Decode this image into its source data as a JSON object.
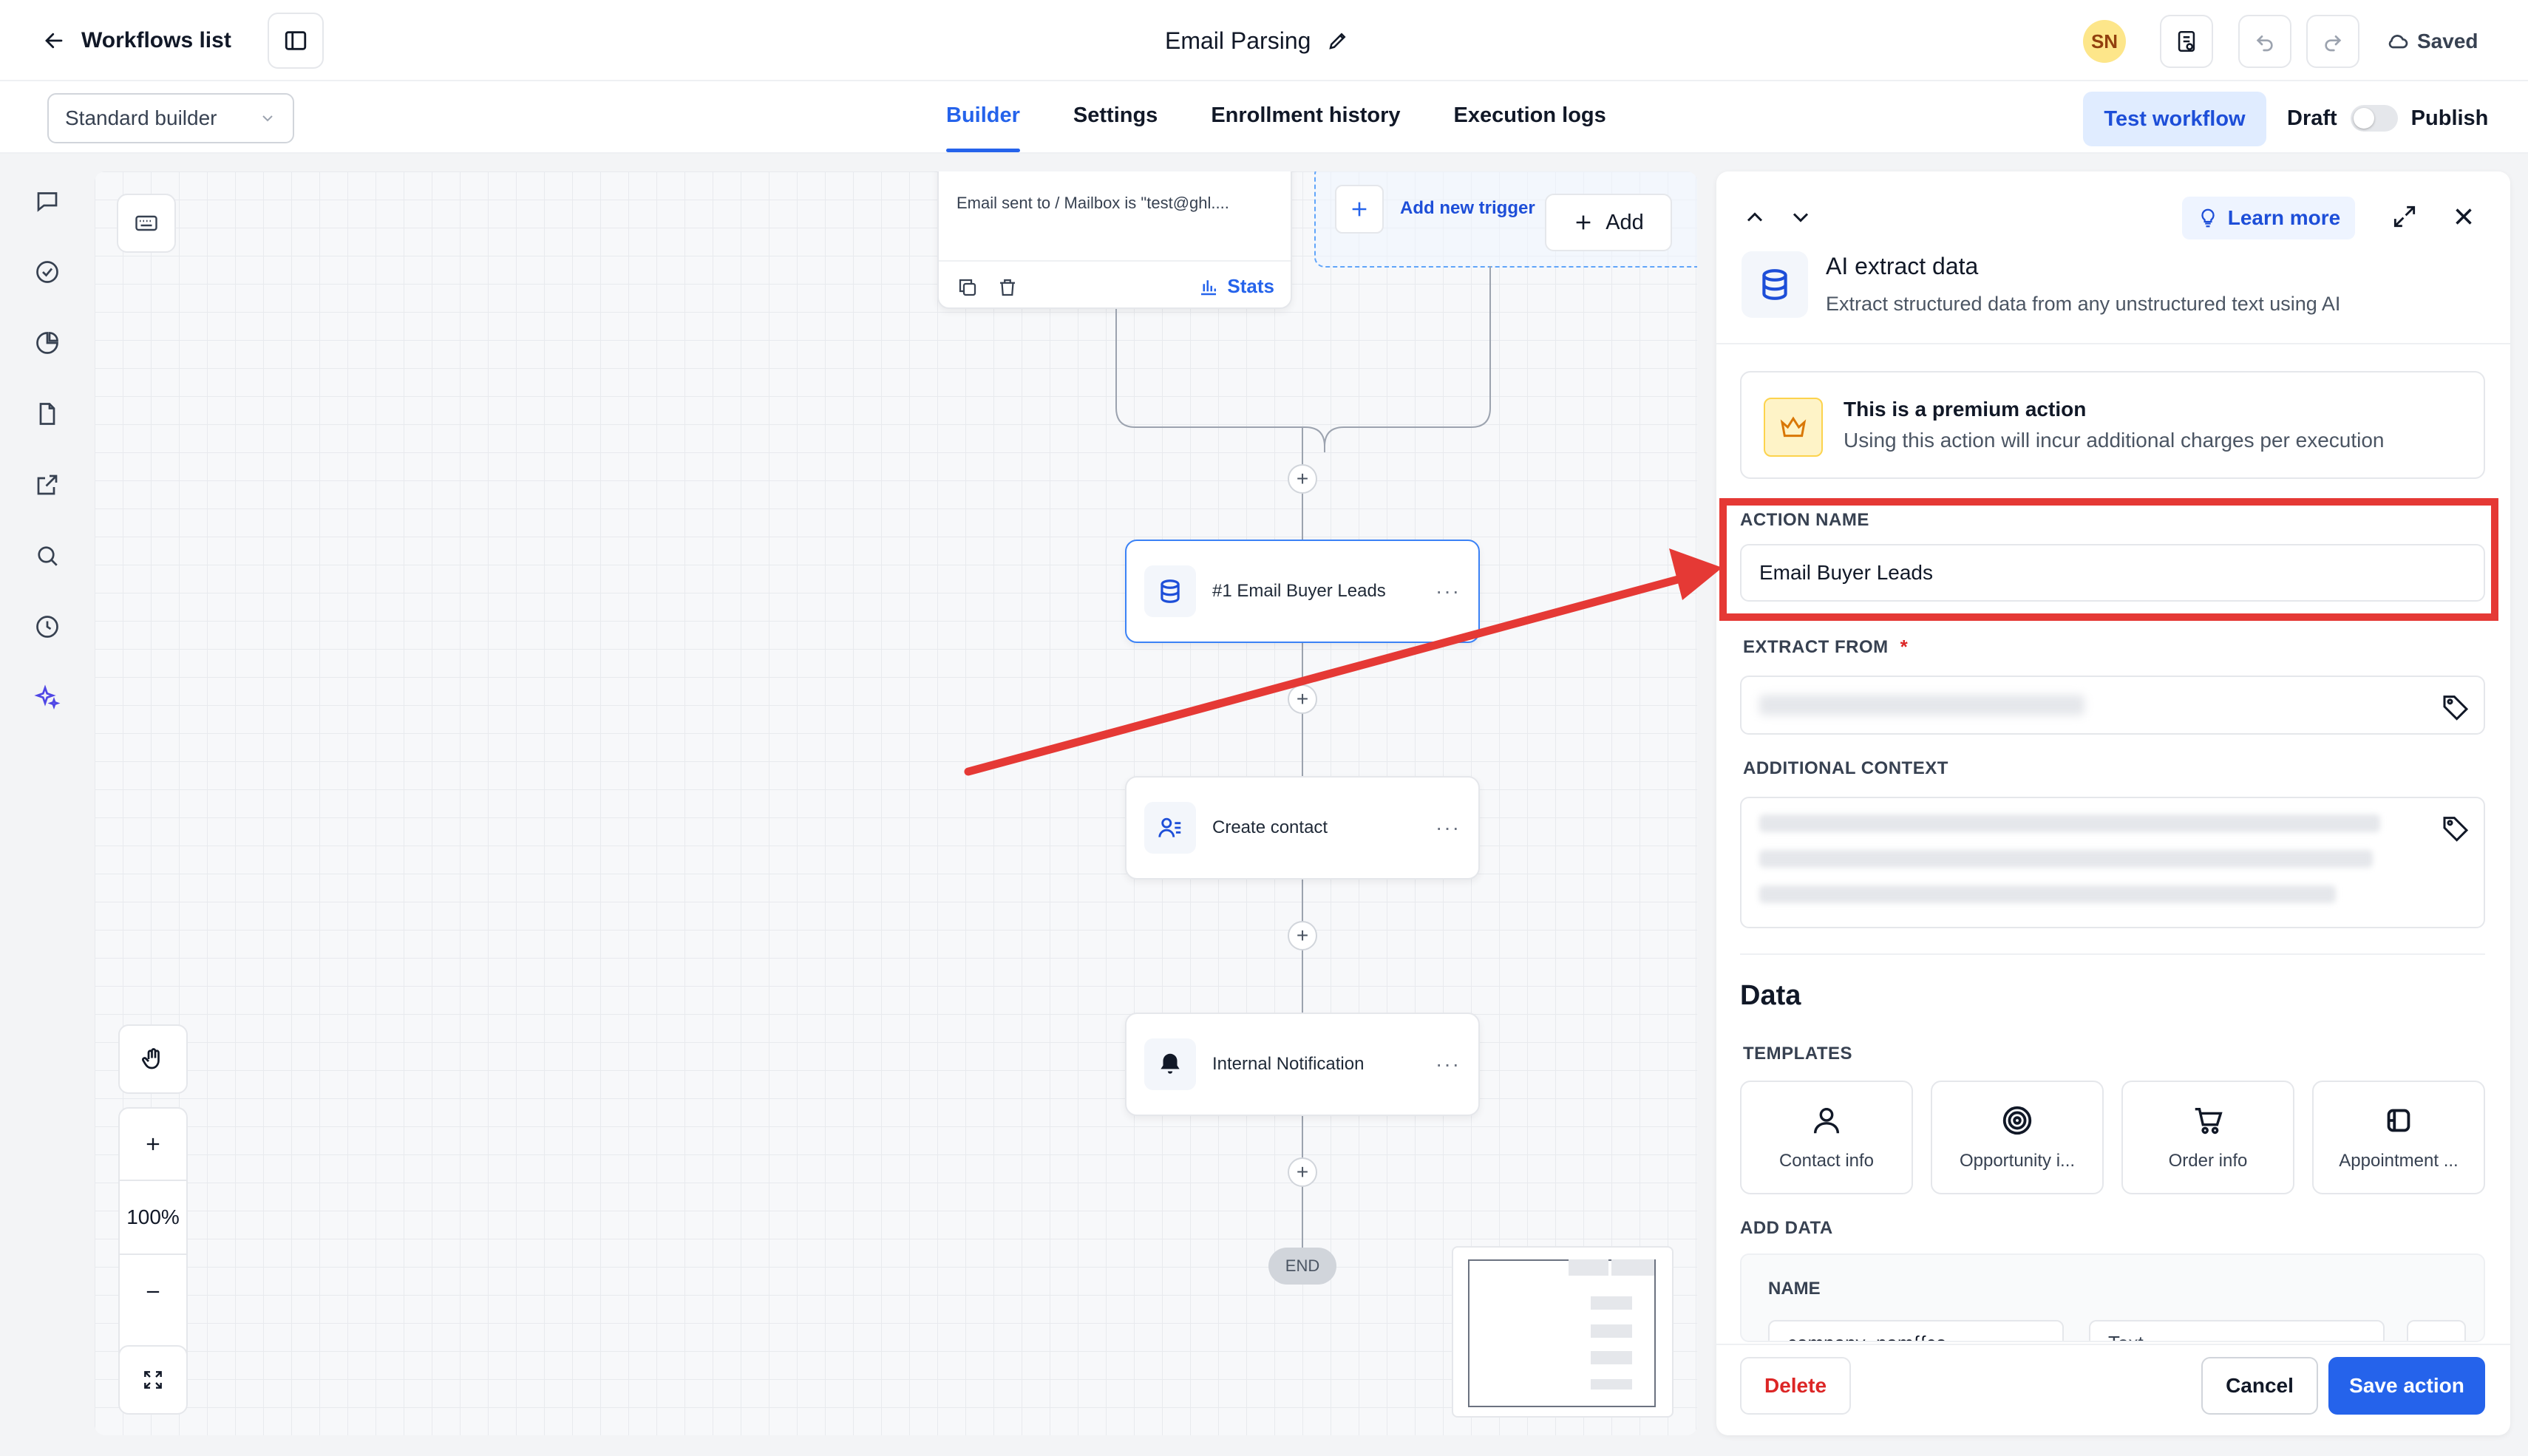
{
  "header": {
    "back_label": "Workflows list",
    "title": "Email Parsing",
    "avatar_initials": "SN",
    "saved_label": "Saved"
  },
  "subbar": {
    "builder_select": "Standard builder",
    "tabs": [
      {
        "label": "Builder",
        "active": true
      },
      {
        "label": "Settings",
        "active": false
      },
      {
        "label": "Enrollment history",
        "active": false
      },
      {
        "label": "Execution logs",
        "active": false
      }
    ],
    "test_workflow": "Test workflow",
    "draft": "Draft",
    "publish": "Publish"
  },
  "canvas": {
    "trigger_card": {
      "text": "Email sent to / Mailbox is \"test@ghl....",
      "stats": "Stats"
    },
    "add_trigger": {
      "label": "Add new trigger",
      "add": "Add"
    },
    "nodes": [
      {
        "label": "#1 Email Buyer Leads",
        "icon": "database-icon",
        "more": "···"
      },
      {
        "label": "Create contact",
        "icon": "contact-icon",
        "more": "···"
      },
      {
        "label": "Internal Notification",
        "icon": "bell-icon",
        "more": "···"
      }
    ],
    "end_label": "END",
    "zoom": "100%"
  },
  "panel": {
    "learn_more": "Learn more",
    "title": "AI extract data",
    "subtitle": "Extract structured data from any unstructured text using AI",
    "premium_title": "This is a premium action",
    "premium_desc": "Using this action will incur additional charges per execution",
    "action_name_label": "ACTION NAME",
    "action_name_value": "Email Buyer Leads",
    "extract_from_label": "EXTRACT FROM",
    "required_mark": "*",
    "additional_context_label": "ADDITIONAL CONTEXT",
    "data_heading": "Data",
    "templates_label": "TEMPLATES",
    "templates": [
      {
        "label": "Contact info",
        "icon": "person-icon"
      },
      {
        "label": "Opportunity i...",
        "icon": "target-icon"
      },
      {
        "label": "Order info",
        "icon": "cart-icon"
      },
      {
        "label": "Appointment ...",
        "icon": "appointment-icon"
      }
    ],
    "add_data_label": "ADD DATA",
    "name_label": "NAME",
    "name_field_partial": "company_nam{{co",
    "type_field_partial": "Text",
    "delete": "Delete",
    "cancel": "Cancel",
    "save": "Save action"
  },
  "colors": {
    "accent": "#2563eb",
    "highlight": "#e53935",
    "danger": "#dc2626"
  }
}
